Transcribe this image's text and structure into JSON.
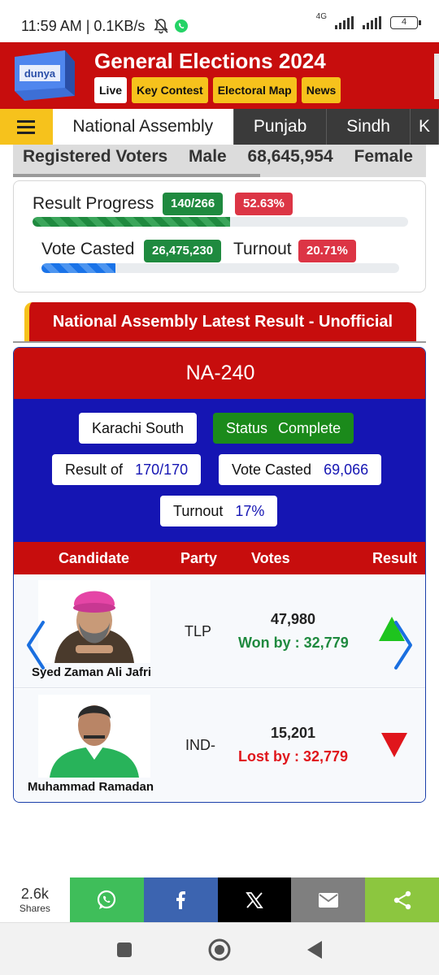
{
  "status_bar": {
    "time": "11:59 AM | 0.1KB/s",
    "network": "4G",
    "battery": "4"
  },
  "header": {
    "logo_text": "dunya",
    "title": "General Elections 2024",
    "chips": [
      "Live",
      "Key Contest",
      "Electoral Map",
      "News"
    ]
  },
  "tabs": [
    "National Assembly",
    "Punjab",
    "Sindh",
    "K"
  ],
  "registered": {
    "label": "Registered Voters",
    "male_label": "Male",
    "male_value": "68,645,954",
    "female_label": "Female"
  },
  "progress": {
    "result_label": "Result Progress",
    "result_count": "140/266",
    "result_percent": "52.63%",
    "result_fill": 0.5263,
    "vote_label": "Vote Casted",
    "vote_count": "26,475,230",
    "turnout_label": "Turnout",
    "turnout_percent": "20.71%",
    "turnout_fill": 0.2071
  },
  "section_title": "National Assembly Latest Result - Unofficial",
  "result": {
    "constituency": "NA-240",
    "district": "Karachi South",
    "status_label": "Status",
    "status_value": "Complete",
    "result_of_label": "Result of",
    "result_of_value": "170/170",
    "vote_casted_label": "Vote Casted",
    "vote_casted_value": "69,066",
    "turnout_label": "Turnout",
    "turnout_value": "17%",
    "columns": [
      "Candidate",
      "Party",
      "Votes",
      "Result"
    ],
    "candidates": [
      {
        "name": "Syed Zaman Ali Jafri",
        "party": "TLP",
        "votes": "47,980",
        "margin": "Won by : 32,779",
        "outcome": "won"
      },
      {
        "name": "Muhammad Ramadan",
        "party": "IND-",
        "votes": "15,201",
        "margin": "Lost by : 32,779",
        "outcome": "lost"
      }
    ]
  },
  "share": {
    "count": "2.6k",
    "label": "Shares",
    "colors": {
      "whatsapp": "#3fbe5a",
      "facebook": "#3c64b0",
      "x": "#000000",
      "email": "#7f7f7f",
      "share": "#8cc63f"
    }
  },
  "colors": {
    "brand_red": "#c70d0d",
    "accent_yellow": "#f6c21c",
    "info_blue": "#1515b3",
    "won_green": "#1f8a3f",
    "lost_red": "#e0161c"
  }
}
